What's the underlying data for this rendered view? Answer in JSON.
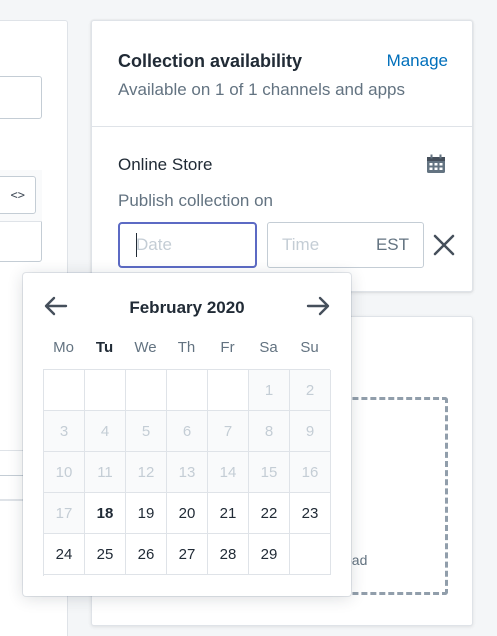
{
  "left_panel": {
    "code_button_label": "<>"
  },
  "availability": {
    "title": "Collection availability",
    "manage_label": "Manage",
    "subtitle": "Available on 1 of 1 channels and apps",
    "channel_name": "Online Store",
    "publish_label": "Publish collection on",
    "date_placeholder": "Date",
    "time_placeholder": "Time",
    "timezone": "EST"
  },
  "media": {
    "upload_text": "oad"
  },
  "datepicker": {
    "month_title": "February 2020",
    "weekdays": [
      "Mo",
      "Tu",
      "We",
      "Th",
      "Fr",
      "Sa",
      "Su"
    ],
    "highlight_weekday": "Tu",
    "days": [
      [
        "",
        "",
        "",
        "",
        "",
        "1",
        "2"
      ],
      [
        "3",
        "4",
        "5",
        "6",
        "7",
        "8",
        "9"
      ],
      [
        "10",
        "11",
        "12",
        "13",
        "14",
        "15",
        "16"
      ],
      [
        "17",
        "18",
        "19",
        "20",
        "21",
        "22",
        "23"
      ],
      [
        "24",
        "25",
        "26",
        "27",
        "28",
        "29",
        ""
      ]
    ],
    "today": "18",
    "first_enabled": "18"
  },
  "colors": {
    "accent": "#5c6ac4",
    "link": "#006fbb",
    "text": "#212b36",
    "muted": "#637381",
    "disabled": "#c4cdd5"
  },
  "icons": {
    "prev": "arrow-left-icon",
    "next": "arrow-right-icon",
    "calendar": "calendar-icon",
    "clear": "close-icon"
  }
}
